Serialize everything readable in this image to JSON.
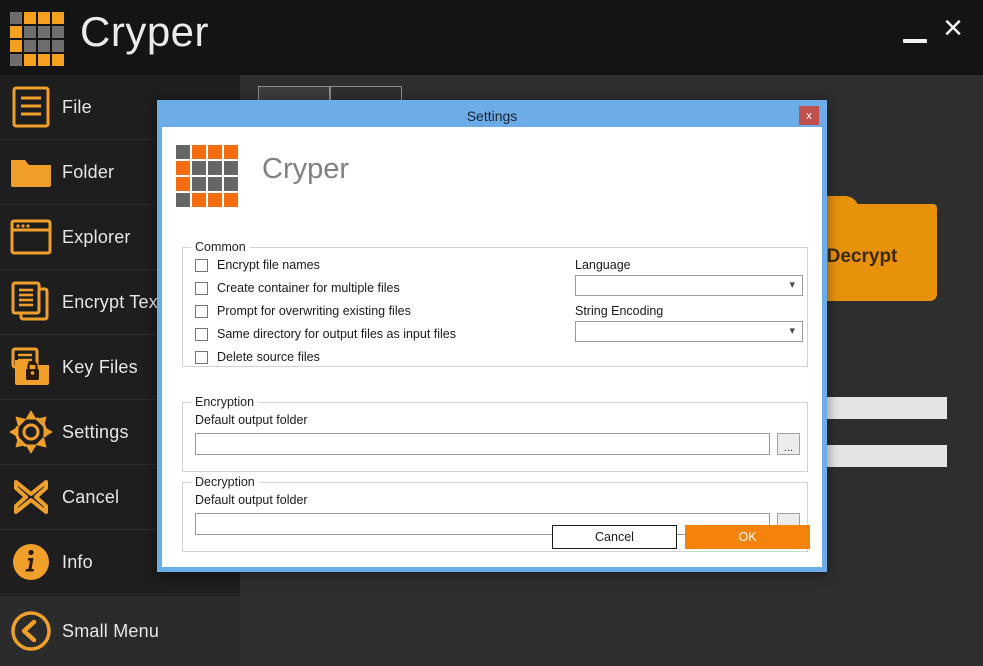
{
  "app": {
    "title": "Cryper",
    "logo_cells": [
      "gray",
      "orange",
      "orange",
      "orange",
      "orange",
      "gray",
      "gray",
      "gray",
      "orange",
      "gray",
      "gray",
      "gray",
      "gray",
      "orange",
      "orange",
      "orange"
    ],
    "colors": {
      "orange": "#f5a01e",
      "gray": "#6e6e6e",
      "dialog_orange": "#f26b0f",
      "dialog_gray": "#666666",
      "accent": "#f5820b",
      "titlebar_blue": "#6cace8"
    },
    "window_controls": {
      "minimize": "minimize-icon",
      "close": "×"
    }
  },
  "sidebar": {
    "items": [
      {
        "label": "File",
        "icon": "file-document-icon"
      },
      {
        "label": "Folder",
        "icon": "folder-icon"
      },
      {
        "label": "Explorer",
        "icon": "explorer-window-icon"
      },
      {
        "label": "Encrypt Text",
        "icon": "documents-stack-icon"
      },
      {
        "label": "Key Files",
        "icon": "key-files-lock-icon"
      },
      {
        "label": "Settings",
        "icon": "gear-icon"
      },
      {
        "label": "Cancel",
        "icon": "cross-icon"
      },
      {
        "label": "Info",
        "icon": "info-circle-icon"
      }
    ],
    "footer": {
      "label": "Small Menu",
      "icon": "chevron-left-circle-icon"
    }
  },
  "main": {
    "tabs": [
      {
        "label": ""
      },
      {
        "label": ""
      }
    ],
    "decrypt_card": {
      "label": "Decrypt",
      "icon": "folder-icon"
    }
  },
  "dialog": {
    "title": "Settings",
    "close_label": "x",
    "brand": "Cryper",
    "logo_cells": [
      "gray",
      "orange",
      "orange",
      "orange",
      "orange",
      "gray",
      "gray",
      "gray",
      "orange",
      "gray",
      "gray",
      "gray",
      "gray",
      "orange",
      "orange",
      "orange"
    ],
    "common": {
      "legend": "Common",
      "checkboxes": [
        {
          "label": "Encrypt file names",
          "checked": false
        },
        {
          "label": "Create container for multiple files",
          "checked": false
        },
        {
          "label": "Prompt for overwriting existing files",
          "checked": false
        },
        {
          "label": "Same directory for output files as input files",
          "checked": false
        },
        {
          "label": "Delete source files",
          "checked": false
        }
      ],
      "language": {
        "label": "Language",
        "value": "",
        "icon": "chevron-down-icon"
      },
      "string_encoding": {
        "label": "String Encoding",
        "value": "",
        "icon": "chevron-down-icon"
      }
    },
    "encryption": {
      "legend": "Encryption",
      "output_label": "Default output folder",
      "output_value": "",
      "browse_label": "..."
    },
    "decryption": {
      "legend": "Decryption",
      "output_label": "Default output folder",
      "output_value": "",
      "browse_label": "..."
    },
    "buttons": {
      "cancel": "Cancel",
      "ok": "OK"
    }
  }
}
